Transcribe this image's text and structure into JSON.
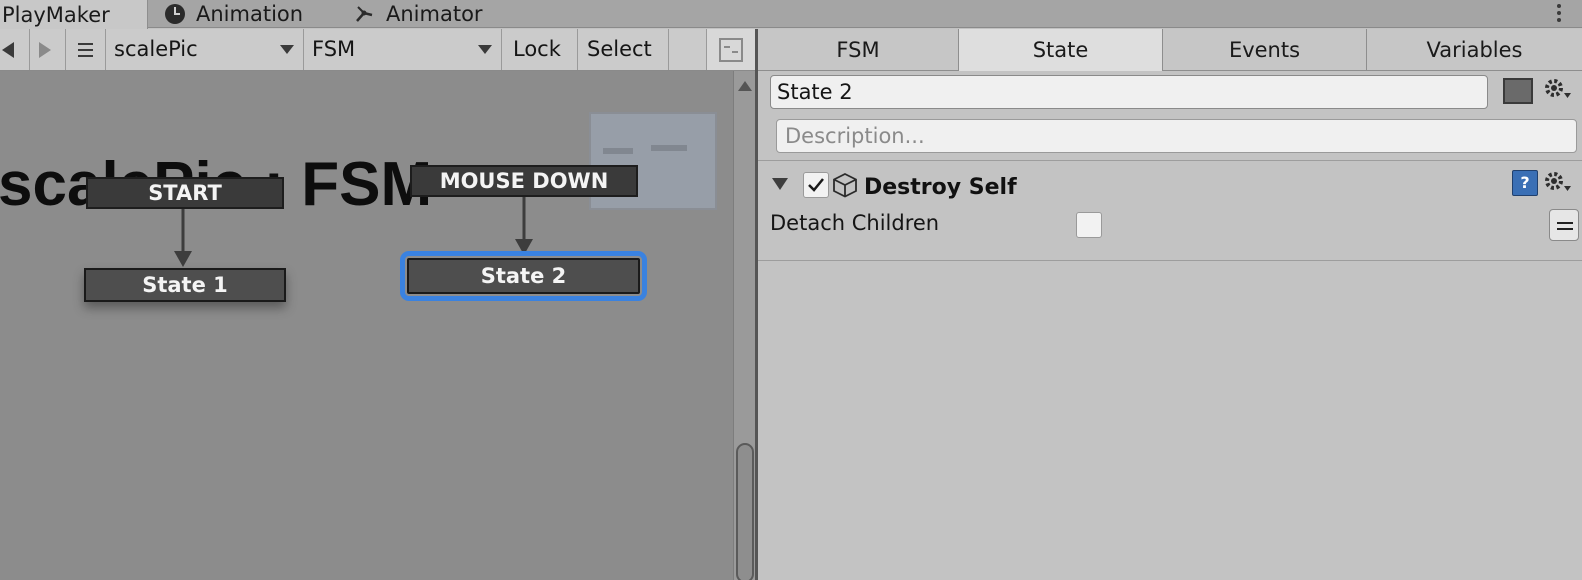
{
  "window_tabs": [
    {
      "label": "PlayMaker",
      "active": true
    },
    {
      "label": "Animation",
      "icon": "clock-icon"
    },
    {
      "label": "Animator",
      "icon": "animator-icon"
    }
  ],
  "toolbar": {
    "back_icon": "back-arrow-icon",
    "forward_icon": "forward-arrow-icon",
    "menu_icon": "hamburger-icon",
    "gameobject_select": "scalePic",
    "fsm_select": "FSM",
    "lock_label": "Lock",
    "select_label": "Select",
    "minimap_toggle_icon": "minimap-icon"
  },
  "graph": {
    "title": "scalePic : FSM",
    "nodes": {
      "start": "START",
      "state1": "State 1",
      "mouse_down": "MOUSE DOWN",
      "state2": "State 2"
    },
    "selected_node": "State 2"
  },
  "inspector": {
    "tabs": [
      {
        "label": "FSM"
      },
      {
        "label": "State",
        "active": true
      },
      {
        "label": "Events"
      },
      {
        "label": "Variables"
      }
    ],
    "state_name": "State 2",
    "description_placeholder": "Description...",
    "state_color": "#6a6a6a",
    "action": {
      "enabled": true,
      "title": "Destroy Self",
      "icon": "cube-icon",
      "param_label": "Detach Children",
      "param_value": false
    }
  },
  "colors": {
    "selection_outline": "#3a82e0",
    "canvas_bg": "#8c8c8c",
    "node_bg": "#4e4e4e"
  }
}
